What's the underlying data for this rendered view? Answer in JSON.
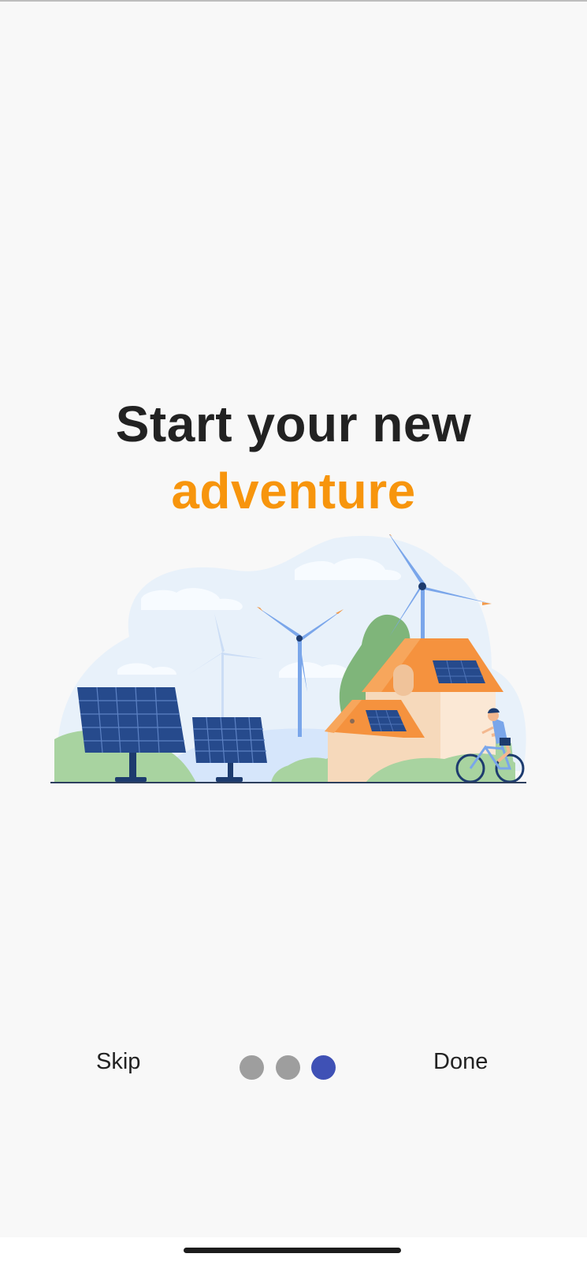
{
  "onboarding": {
    "title_line1": "Start your new",
    "title_line2": "adventure",
    "accent_color": "#f7950d",
    "illustration": {
      "icon": "renewable-energy-illustration",
      "elements": [
        "solar-panels",
        "wind-turbines",
        "house-with-solar-roof",
        "cyclist"
      ]
    }
  },
  "footer": {
    "skip_label": "Skip",
    "done_label": "Done",
    "page_count": 3,
    "active_page": 3,
    "dot_color": "#9e9e9e",
    "active_dot_color": "#3f51b5"
  },
  "system": {
    "home_indicator": "home-indicator"
  }
}
